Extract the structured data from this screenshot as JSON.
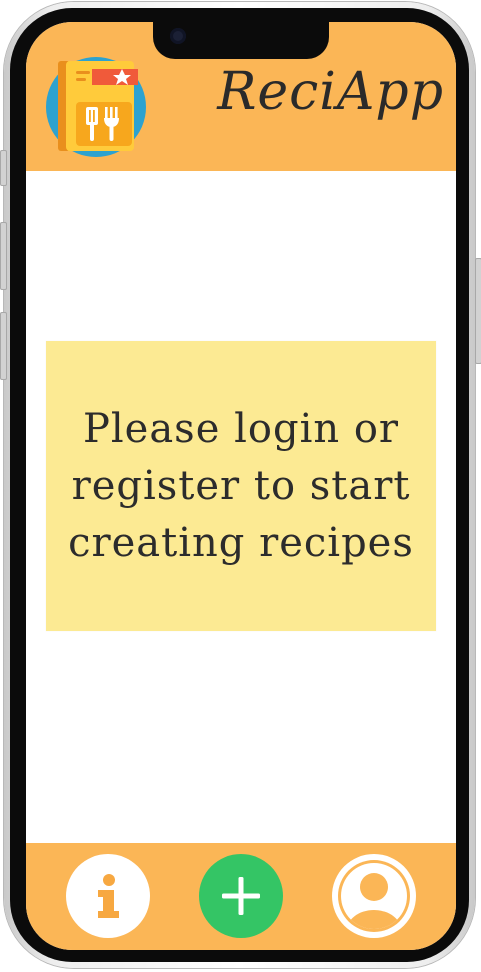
{
  "app": {
    "title": "ReciApp",
    "accent_color": "#fbb656",
    "logo_icon": "recipe-book-icon"
  },
  "main": {
    "message": "Please login or register to start creating recipes",
    "message_bg": "#fcea93"
  },
  "bottom_nav": {
    "items": [
      {
        "name": "info",
        "icon": "info-icon"
      },
      {
        "name": "add",
        "icon": "plus-icon",
        "color": "#34c565"
      },
      {
        "name": "profile",
        "icon": "user-icon"
      }
    ]
  }
}
